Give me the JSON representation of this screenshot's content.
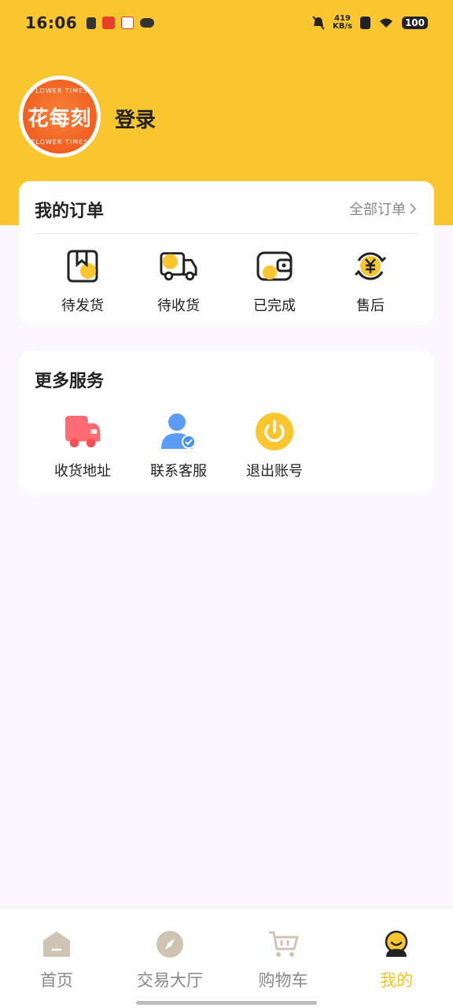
{
  "status_bar": {
    "time": "16:06",
    "net_speed_value": "419",
    "net_speed_unit": "KB/s",
    "battery": "100"
  },
  "profile": {
    "avatar_logo": "花每刻",
    "avatar_sub_top": "FLOWER TIMES",
    "avatar_sub_bottom": "FLOWER TIMES",
    "login_label": "登录"
  },
  "orders": {
    "title": "我的订单",
    "all_link": "全部订单",
    "items": [
      {
        "label": "待发货",
        "icon": "package-icon"
      },
      {
        "label": "待收货",
        "icon": "truck-icon"
      },
      {
        "label": "已完成",
        "icon": "wallet-icon"
      },
      {
        "label": "售后",
        "icon": "yen-refresh-icon"
      }
    ]
  },
  "services": {
    "title": "更多服务",
    "items": [
      {
        "label": "收货地址",
        "icon": "delivery-truck-icon"
      },
      {
        "label": "联系客服",
        "icon": "customer-service-icon"
      },
      {
        "label": "退出账号",
        "icon": "power-icon"
      }
    ]
  },
  "bottom_nav": {
    "items": [
      {
        "label": "首页",
        "icon": "home-icon"
      },
      {
        "label": "交易大厅",
        "icon": "compass-icon"
      },
      {
        "label": "购物车",
        "icon": "cart-icon"
      },
      {
        "label": "我的",
        "icon": "profile-icon",
        "active": true
      }
    ]
  },
  "colors": {
    "accent": "#f9c630",
    "active_nav": "#f5c32c",
    "inactive_nav": "#888888",
    "page_bg": "#fcf6ff"
  }
}
